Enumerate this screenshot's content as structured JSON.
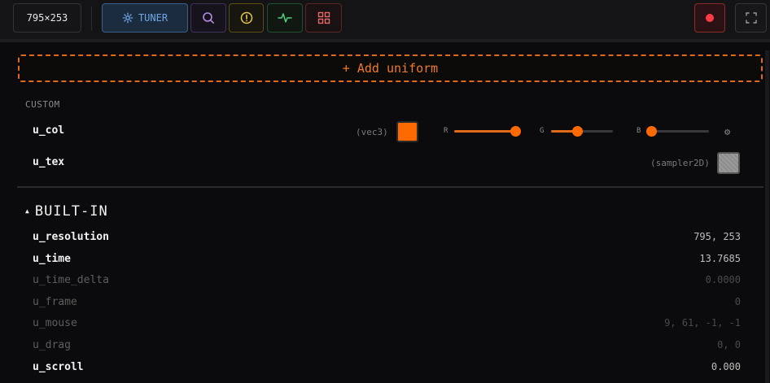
{
  "toolbar": {
    "resolution": "795×253",
    "tuner_label": "TUNER",
    "icons": [
      "gear-icon",
      "search-icon",
      "alert-icon",
      "pulse-icon",
      "grid-icon",
      "record-icon",
      "expand-icon"
    ]
  },
  "add_uniform_label": "+ Add uniform",
  "custom": {
    "section_label": "CUSTOM",
    "uniforms": [
      {
        "name": "u_col",
        "type": "(vec3)",
        "color": "#ff6a00",
        "channels": [
          {
            "label": "R",
            "value": 1.0
          },
          {
            "label": "G",
            "value": 0.42
          },
          {
            "label": "B",
            "value": 0.0
          }
        ]
      },
      {
        "name": "u_tex",
        "type": "(sampler2D)"
      }
    ]
  },
  "builtin": {
    "heading": "BUILT-IN",
    "rows": [
      {
        "name": "u_resolution",
        "value": "795, 253",
        "active": true
      },
      {
        "name": "u_time",
        "value": "13.7685",
        "active": true
      },
      {
        "name": "u_time_delta",
        "value": "0.0000",
        "active": false
      },
      {
        "name": "u_frame",
        "value": "0",
        "active": false
      },
      {
        "name": "u_mouse",
        "value": "9, 61, -1, -1",
        "active": false
      },
      {
        "name": "u_drag",
        "value": "0, 0",
        "active": false
      },
      {
        "name": "u_scroll",
        "value": "0.000",
        "active": true
      }
    ]
  },
  "colors": {
    "accent_orange": "#e0691a",
    "tuner_blue": "#6fa8e8",
    "record_red": "#ff3b47"
  }
}
